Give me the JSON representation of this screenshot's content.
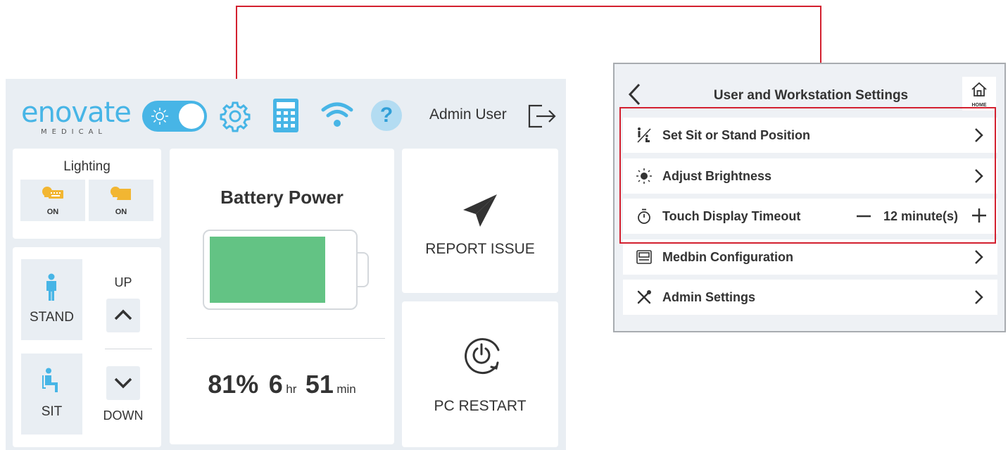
{
  "colors": {
    "accent": "#47b5e6",
    "battery": "#63c384",
    "callout": "#d3202f",
    "lightbulb": "#f2b632"
  },
  "header": {
    "logo_word": "enovate",
    "logo_sub": "MEDICAL",
    "user_name": "Admin User",
    "icons": [
      "brightness-toggle",
      "gear-icon",
      "calculator-icon",
      "wifi-icon",
      "help-icon",
      "logout-icon"
    ],
    "help_glyph": "?"
  },
  "lighting": {
    "title": "Lighting",
    "buttons": [
      {
        "icon": "keyboard-light-icon",
        "label": "ON"
      },
      {
        "icon": "task-light-icon",
        "label": "ON"
      }
    ]
  },
  "height": {
    "stand_label": "STAND",
    "sit_label": "SIT",
    "up_label": "UP",
    "down_label": "DOWN"
  },
  "battery": {
    "title": "Battery Power",
    "level_percent": 81,
    "percent_text": "81%",
    "hours": "6",
    "hours_unit": "hr",
    "minutes": "51",
    "minutes_unit": "min"
  },
  "actions": {
    "report_label": "REPORT ISSUE",
    "restart_label": "PC RESTART"
  },
  "settings": {
    "title": "User and Workstation Settings",
    "home_label": "HOME",
    "rows": [
      {
        "label": "Set Sit or Stand Position",
        "icon": "sit-stand-icon"
      },
      {
        "label": "Adjust Brightness",
        "icon": "brightness-icon"
      },
      {
        "label": "Touch Display Timeout",
        "icon": "timer-icon",
        "value": "12 minute(s)"
      },
      {
        "label": "Medbin Configuration",
        "icon": "medbin-icon"
      },
      {
        "label": "Admin Settings",
        "icon": "tools-icon"
      }
    ]
  }
}
